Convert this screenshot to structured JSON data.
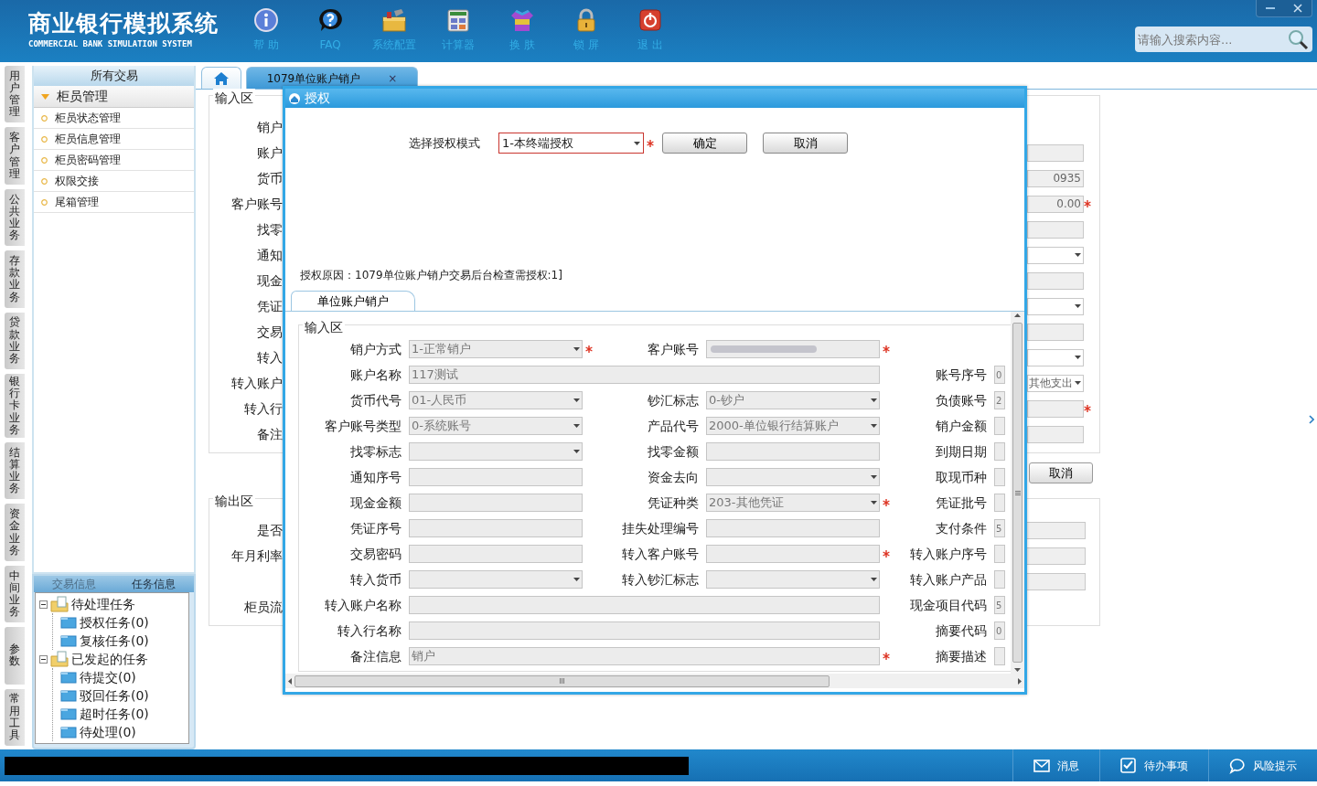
{
  "app": {
    "title": "商业银行模拟系统",
    "subtitle": "COMMERCIAL BANK SIMULATION SYSTEM"
  },
  "toolbar": [
    {
      "label": "帮 助",
      "kind": "info"
    },
    {
      "label": "FAQ",
      "kind": "question"
    },
    {
      "label": "系统配置",
      "kind": "toolbox"
    },
    {
      "label": "计算器",
      "kind": "calculator"
    },
    {
      "label": "换 肤",
      "kind": "shirt"
    },
    {
      "label": "锁 屏",
      "kind": "padlock"
    },
    {
      "label": "退 出",
      "kind": "power"
    }
  ],
  "search": {
    "placeholder": "请输入搜索内容..."
  },
  "module_tabs": [
    {
      "label": "用户管理"
    },
    {
      "label": "客户管理"
    },
    {
      "label": "公共业务"
    },
    {
      "label": "存款业务"
    },
    {
      "label": "贷款业务"
    },
    {
      "label": "银行卡业务"
    },
    {
      "label": "结算业务"
    },
    {
      "label": "资金业务"
    },
    {
      "label": "中间业务"
    },
    {
      "label": "参数"
    },
    {
      "label": "常用工具"
    }
  ],
  "sidebar": {
    "title": "所有交易",
    "groups": [
      {
        "label": "柜员管理",
        "expanded": true,
        "items": [
          "柜员状态管理",
          "柜员信息管理",
          "柜员密码管理",
          "权限交接",
          "尾箱管理"
        ]
      }
    ]
  },
  "task_panel": {
    "tabs": [
      {
        "label": "交易信息",
        "selected": false
      },
      {
        "label": "任务信息",
        "selected": true
      }
    ],
    "tree": [
      {
        "label": "待处理任务",
        "expanded": true,
        "children": [
          {
            "label": "授权任务(0)"
          },
          {
            "label": "复核任务(0)"
          }
        ]
      },
      {
        "label": "已发起的任务",
        "expanded": true,
        "children": [
          {
            "label": "待提交(0)"
          },
          {
            "label": "驳回任务(0)"
          },
          {
            "label": "超时任务(0)"
          },
          {
            "label": "待处理(0)"
          }
        ]
      }
    ]
  },
  "tabs": [
    {
      "kind": "home",
      "selected": false
    },
    {
      "kind": "page",
      "label": "1079单位账户销户",
      "selected": true,
      "close": "×"
    }
  ],
  "form": {
    "input_legend": "输入区",
    "rows": [
      {
        "label": "销户"
      },
      {
        "label": "账户",
        "field": {
          "kind": "text"
        }
      },
      {
        "label": "货币",
        "field": {
          "kind": "text",
          "value": "0935"
        }
      },
      {
        "label": "客户账号",
        "field": {
          "kind": "text",
          "value": "0.00",
          "required": true
        }
      },
      {
        "label": "找零",
        "field": {
          "kind": "text"
        }
      },
      {
        "label": "通知",
        "field": {
          "kind": "select"
        }
      },
      {
        "label": "现金",
        "field": {
          "kind": "text"
        }
      },
      {
        "label": "凭证",
        "field": {
          "kind": "select"
        }
      },
      {
        "label": "交易",
        "field": {
          "kind": "text"
        }
      },
      {
        "label": "转入",
        "field": {
          "kind": "select"
        }
      },
      {
        "label": "转入账户",
        "field": {
          "kind": "select",
          "value": "其他支出"
        }
      },
      {
        "label": "转入行",
        "field": {
          "kind": "text",
          "required": true
        }
      },
      {
        "label": "备注",
        "field": {
          "kind": "text"
        }
      }
    ],
    "cancel_button": "取消",
    "output_legend": "输出区",
    "output_rows": [
      {
        "label": "是否",
        "field": true
      },
      {
        "label": "年月利率",
        "field": true
      },
      {
        "field": true
      },
      {
        "label": "柜员流",
        "field": false
      }
    ]
  },
  "dialog": {
    "title": "授权",
    "mode_label": "选择授权模式",
    "mode_value": "1-本终端授权",
    "mode_required": true,
    "mode_invalid": true,
    "buttons": [
      "确定",
      "取消"
    ],
    "reason": "授权原因：1079单位账户销户交易后台检查需授权:1]",
    "tab": "单位账户销户",
    "legend": "输入区",
    "rows": [
      {
        "cells": [
          {
            "label": "销户方式",
            "kind": "select",
            "value": "1-正常销户",
            "required": true
          },
          {
            "label": "客户账号",
            "kind": "masked",
            "required": true
          }
        ]
      },
      {
        "cells": [
          {
            "label": "账户名称",
            "kind": "text",
            "value": "117测试",
            "wide": true
          },
          {
            "label": "账号序号",
            "kind": "text",
            "value": "0"
          }
        ]
      },
      {
        "cells": [
          {
            "label": "货币代号",
            "kind": "select",
            "value": "01-人民币"
          },
          {
            "label": "钞汇标志",
            "kind": "select",
            "value": "0-钞户"
          },
          {
            "label": "负债账号",
            "kind": "text",
            "value": "2"
          }
        ]
      },
      {
        "cells": [
          {
            "label": "客户账号类型",
            "kind": "select",
            "value": "0-系统账号"
          },
          {
            "label": "产品代号",
            "kind": "select",
            "value": "2000-单位银行结算账户"
          },
          {
            "label": "销户金额",
            "kind": "text"
          }
        ]
      },
      {
        "cells": [
          {
            "label": "找零标志",
            "kind": "select"
          },
          {
            "label": "找零金额",
            "kind": "text"
          },
          {
            "label": "到期日期",
            "kind": "text"
          }
        ]
      },
      {
        "cells": [
          {
            "label": "通知序号",
            "kind": "text"
          },
          {
            "label": "资金去向",
            "kind": "select"
          },
          {
            "label": "取现币种",
            "kind": "text"
          }
        ]
      },
      {
        "cells": [
          {
            "label": "现金金额",
            "kind": "text"
          },
          {
            "label": "凭证种类",
            "kind": "select",
            "value": "203-其他凭证",
            "required": true
          },
          {
            "label": "凭证批号",
            "kind": "text"
          }
        ]
      },
      {
        "cells": [
          {
            "label": "凭证序号",
            "kind": "text"
          },
          {
            "label": "挂失处理编号",
            "kind": "text"
          },
          {
            "label": "支付条件",
            "kind": "text",
            "value": "5"
          }
        ]
      },
      {
        "cells": [
          {
            "label": "交易密码",
            "kind": "text"
          },
          {
            "label": "转入客户账号",
            "kind": "text",
            "required": true
          },
          {
            "label": "转入账户序号",
            "kind": "text"
          }
        ]
      },
      {
        "cells": [
          {
            "label": "转入货币",
            "kind": "select"
          },
          {
            "label": "转入钞汇标志",
            "kind": "select"
          },
          {
            "label": "转入账户产品",
            "kind": "text"
          }
        ]
      },
      {
        "cells": [
          {
            "label": "转入账户名称",
            "kind": "text",
            "wide": true
          },
          {
            "label": "现金项目代码",
            "kind": "text",
            "value": "5"
          }
        ]
      },
      {
        "cells": [
          {
            "label": "转入行名称",
            "kind": "text",
            "wide": true
          },
          {
            "label": "摘要代码",
            "kind": "text",
            "value": "0"
          }
        ]
      },
      {
        "cells": [
          {
            "label": "备注信息",
            "kind": "text",
            "value": "销户",
            "wide": true,
            "required": true
          },
          {
            "label": "摘要描述",
            "kind": "text"
          }
        ]
      }
    ]
  },
  "status_bar": {
    "items": [
      {
        "label": "消息",
        "kind": "mail"
      },
      {
        "label": "待办事项",
        "kind": "check"
      },
      {
        "label": "风险提示",
        "kind": "chat"
      }
    ]
  }
}
